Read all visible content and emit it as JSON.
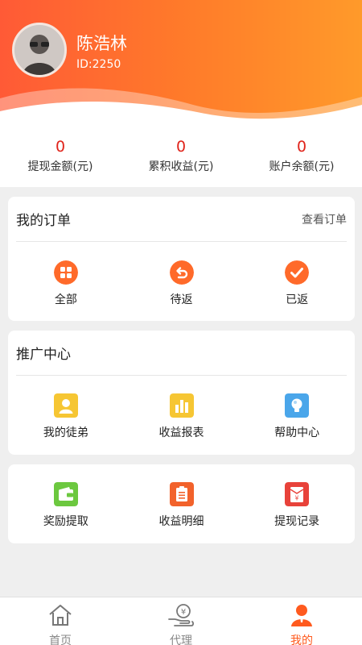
{
  "profile": {
    "name": "陈浩林",
    "id_text": "ID:2250"
  },
  "stats": [
    {
      "value": "0",
      "label": "提现金额(元)"
    },
    {
      "value": "0",
      "label": "累积收益(元)"
    },
    {
      "value": "0",
      "label": "账户余额(元)"
    }
  ],
  "orders": {
    "title": "我的订单",
    "view_all": "查看订单",
    "items": [
      {
        "label": "全部",
        "icon": "grid-icon"
      },
      {
        "label": "待返",
        "icon": "return-arrow-icon"
      },
      {
        "label": "已返",
        "icon": "check-icon"
      }
    ]
  },
  "promo": {
    "title": "推广中心",
    "items": [
      {
        "label": "我的徒弟",
        "icon": "person-icon"
      },
      {
        "label": "收益报表",
        "icon": "bar-chart-icon"
      },
      {
        "label": "帮助中心",
        "icon": "bulb-icon"
      }
    ]
  },
  "more": {
    "items": [
      {
        "label": "奖励提取",
        "icon": "wallet-icon"
      },
      {
        "label": "收益明细",
        "icon": "clipboard-icon"
      },
      {
        "label": "提现记录",
        "icon": "yen-envelope-icon"
      }
    ]
  },
  "tabbar": [
    {
      "label": "首页",
      "icon": "home-icon",
      "active": false
    },
    {
      "label": "代理",
      "icon": "yen-hand-icon",
      "active": false
    },
    {
      "label": "我的",
      "icon": "user-icon",
      "active": true
    }
  ],
  "colors": {
    "accent": "#ff5a1e",
    "value_red": "#e0241b",
    "header_start": "#ff5a36",
    "header_end": "#ff9a2a"
  }
}
